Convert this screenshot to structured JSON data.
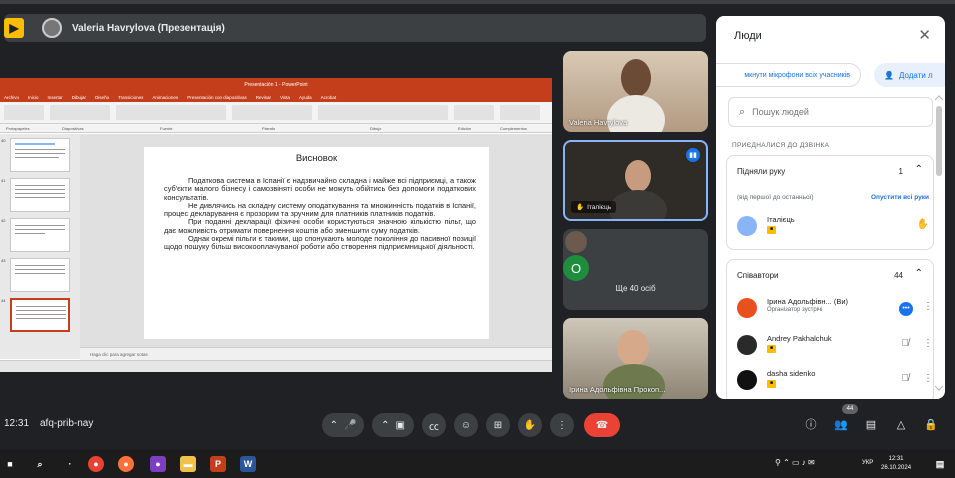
{
  "presenting": {
    "title": "Valeria Havrylova (Презентація)"
  },
  "ppt": {
    "window_title": "Presentación 1 - PowerPoint",
    "tabs": [
      "Archivo",
      "Inicio",
      "Insertar",
      "Dibujar",
      "Diseño",
      "Transiciones",
      "Animaciones",
      "Presentación con diapositivas",
      "Revisar",
      "Vista",
      "Ayuda",
      "Acrobat"
    ],
    "ribbon_groups": [
      "Portapapeles",
      "Diapositivas",
      "Fuente",
      "Párrafo",
      "Dibujo",
      "Edición",
      "Complementos"
    ],
    "thumb_numbers": [
      "40",
      "41",
      "42",
      "43",
      "44"
    ],
    "notes_placeholder": "Haga clic para agregar notas",
    "slide": {
      "title": "Висновок",
      "paragraphs": [
        "Податкова система в Іспанії є надзвичайно складна і майже всі підприємці, а також суб'єкти малого бізнесу і самозвіняті особи не можуть обійтись без допомоги податкових консультатів.",
        "Не дивлячись на складну систему оподаткування та множинність податків в Іспанії, процес декларування є прозорим та зручним для платників платників податків.",
        "При поданні декларації фізичні особи користуються значною кількістю пільг, що дає можливість отримати повернення коштів або зменшити суму податків.",
        "Однак окремі пільги є такими, що спонукають молоде покоління до пасивної позиції щодо пошуку більш високооплачуваної роботи або створення підприємницької діяльності."
      ]
    }
  },
  "tiles": {
    "valeria": "Valeria Havrylova",
    "italiets": "Італієць",
    "others_label": "Ще 40 осіб",
    "others_initial": "O",
    "iryna": "Ірина Адольфівна Прокоп..."
  },
  "panel": {
    "title": "Люди",
    "mute_all": "мкнути мікрофони всіх учасників",
    "add_people": "Додати л",
    "search_placeholder": "Пошук людей",
    "joined_label": "ПРИЄДНАЛИСЯ ДО ДЗВІНКА",
    "hands": {
      "header": "Підняли руку",
      "count": "1",
      "sort_label": "(від першої до останньої)",
      "lower_all": "Опустити всі руки",
      "people": [
        {
          "name": "Італієць",
          "color": "#8ab4f8"
        }
      ]
    },
    "cohosts": {
      "header": "Співавтори",
      "count": "44",
      "people": [
        {
          "name": "Ірина Адольфівн...",
          "suffix": "(Ви)",
          "sub": "Організатор зустрічі",
          "color": "#e8501d"
        },
        {
          "name": "Andrey Pakhalchuk",
          "sub": "",
          "color": "#2a2a2a"
        },
        {
          "name": "dasha sidenko",
          "sub": "",
          "color": "#111111"
        }
      ]
    }
  },
  "bottom": {
    "time": "12:31",
    "meeting_code": "afq-prib-nay",
    "people_badge": "44"
  },
  "taskbar": {
    "lang": "УКР",
    "clock": "12:31",
    "date": "26.10.2024"
  },
  "colors": {
    "end_call": "#ea4335",
    "accent": "#1a73e8",
    "ppt_red": "#c43e1c"
  }
}
